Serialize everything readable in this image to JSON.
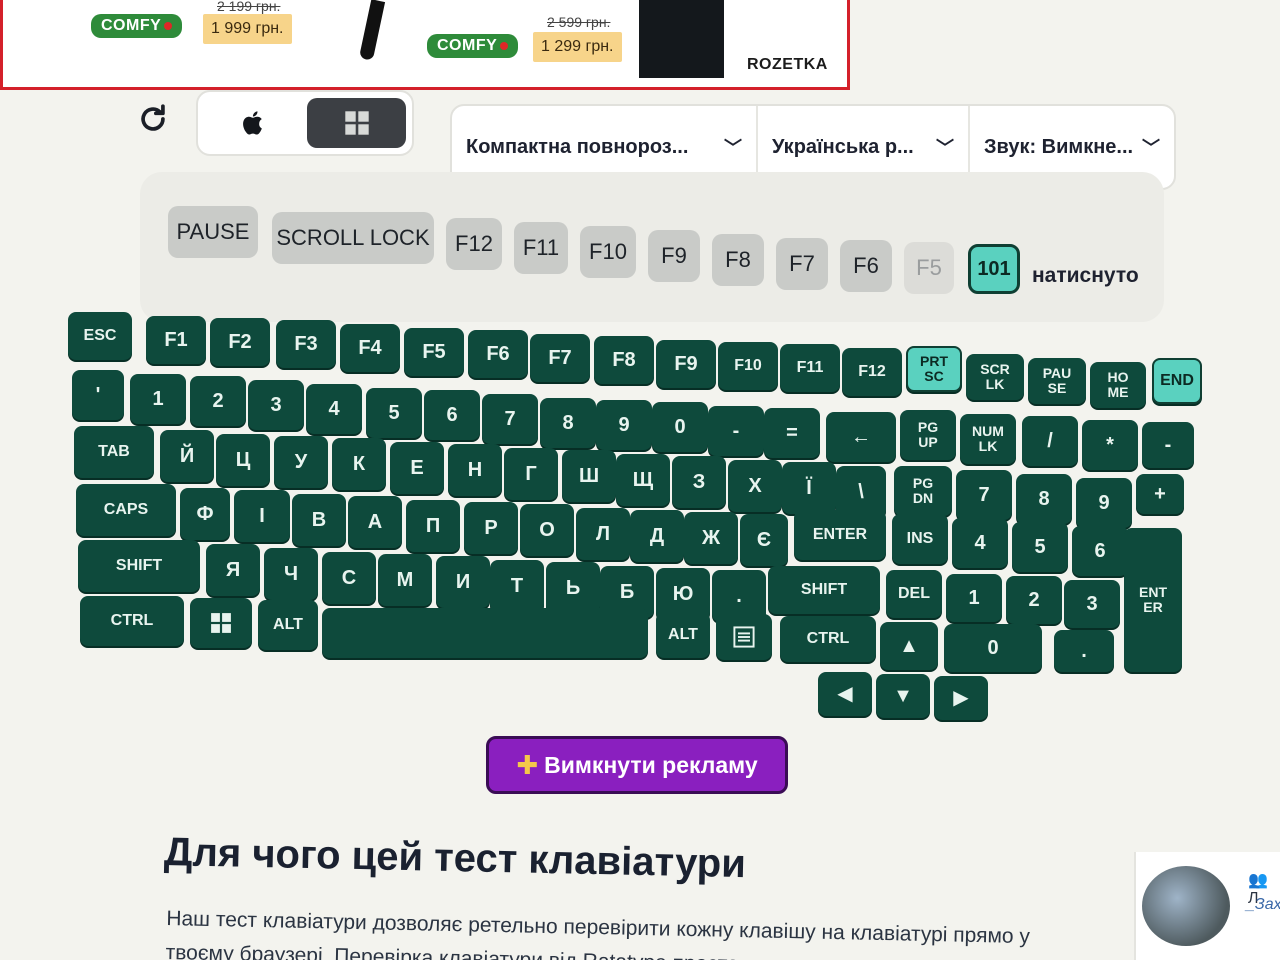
{
  "ad": {
    "badge": "COMFY",
    "items": [
      {
        "old_price": "2 199 грн.",
        "price": "1 999 грн."
      },
      {
        "old_price": "2 599 грн.",
        "price": "1 299 грн."
      }
    ],
    "store": "ROZETKA"
  },
  "toolbar": {
    "os_options": [
      "apple-icon",
      "windows-icon"
    ],
    "active_os": "windows",
    "dropdowns": [
      {
        "value": "Компактна повнороз..."
      },
      {
        "value": "Українська р..."
      },
      {
        "value": "Звук: Вимкне..."
      }
    ]
  },
  "pressed": {
    "keys": [
      "PAUSE",
      "SCROLL LOCK",
      "F12",
      "F11",
      "F10",
      "F9",
      "F8",
      "F7",
      "F6",
      "F5"
    ],
    "count": "101",
    "label": "натиснуто"
  },
  "keyboard": {
    "row_f": [
      "ESC",
      "F1",
      "F2",
      "F3",
      "F4",
      "F5",
      "F6",
      "F7",
      "F8",
      "F9",
      "F10",
      "F11",
      "F12",
      "PRT SC",
      "SCR LK",
      "PAU SE",
      "HO ME",
      "END"
    ],
    "row_num": [
      "'",
      "1",
      "2",
      "3",
      "4",
      "5",
      "6",
      "7",
      "8",
      "9",
      "0",
      "-",
      "=",
      "←",
      "PG UP",
      "NUM LK",
      "/",
      "*",
      "-"
    ],
    "row_tab": [
      "TAB",
      "Й",
      "Ц",
      "У",
      "К",
      "Е",
      "Н",
      "Г",
      "Ш",
      "Щ",
      "З",
      "Х",
      "Ї",
      "\\",
      "PG DN",
      "7",
      "8",
      "9",
      "+"
    ],
    "row_caps": [
      "CAPS",
      "Ф",
      "І",
      "В",
      "А",
      "П",
      "Р",
      "О",
      "Л",
      "Д",
      "Ж",
      "Є",
      "ENTER",
      "INS",
      "4",
      "5",
      "6"
    ],
    "row_shift": [
      "SHIFT",
      "Я",
      "Ч",
      "С",
      "М",
      "И",
      "Т",
      "Ь",
      "Б",
      "Ю",
      ".",
      "SHIFT",
      "DEL",
      "1",
      "2",
      "3",
      "ENT ER"
    ],
    "row_ctrl": [
      "CTRL",
      "windows-icon",
      "ALT",
      "",
      "ALT",
      "menu-icon",
      "CTRL",
      "▲",
      "0",
      "."
    ],
    "row_arrows": [
      "◀",
      "▼",
      "▶"
    ]
  },
  "cta": {
    "label": "Вимкнути рекламу"
  },
  "article": {
    "heading": "Для чого цей тест клавіатури",
    "text": "Наш тест клавіатури дозволяє ретельно перевірити кожну клавішу на клавіатурі прямо у твоєму браузері. Перевірка клавіатури від Ratatype проста, швидка"
  },
  "sidebar": {
    "label": "Л",
    "link": "_Захі"
  },
  "colors": {
    "key": "#0e4a3c",
    "key_pressed": "#5ad1bf",
    "cta": "#8a1fbf",
    "ad_border": "#d4202a"
  }
}
